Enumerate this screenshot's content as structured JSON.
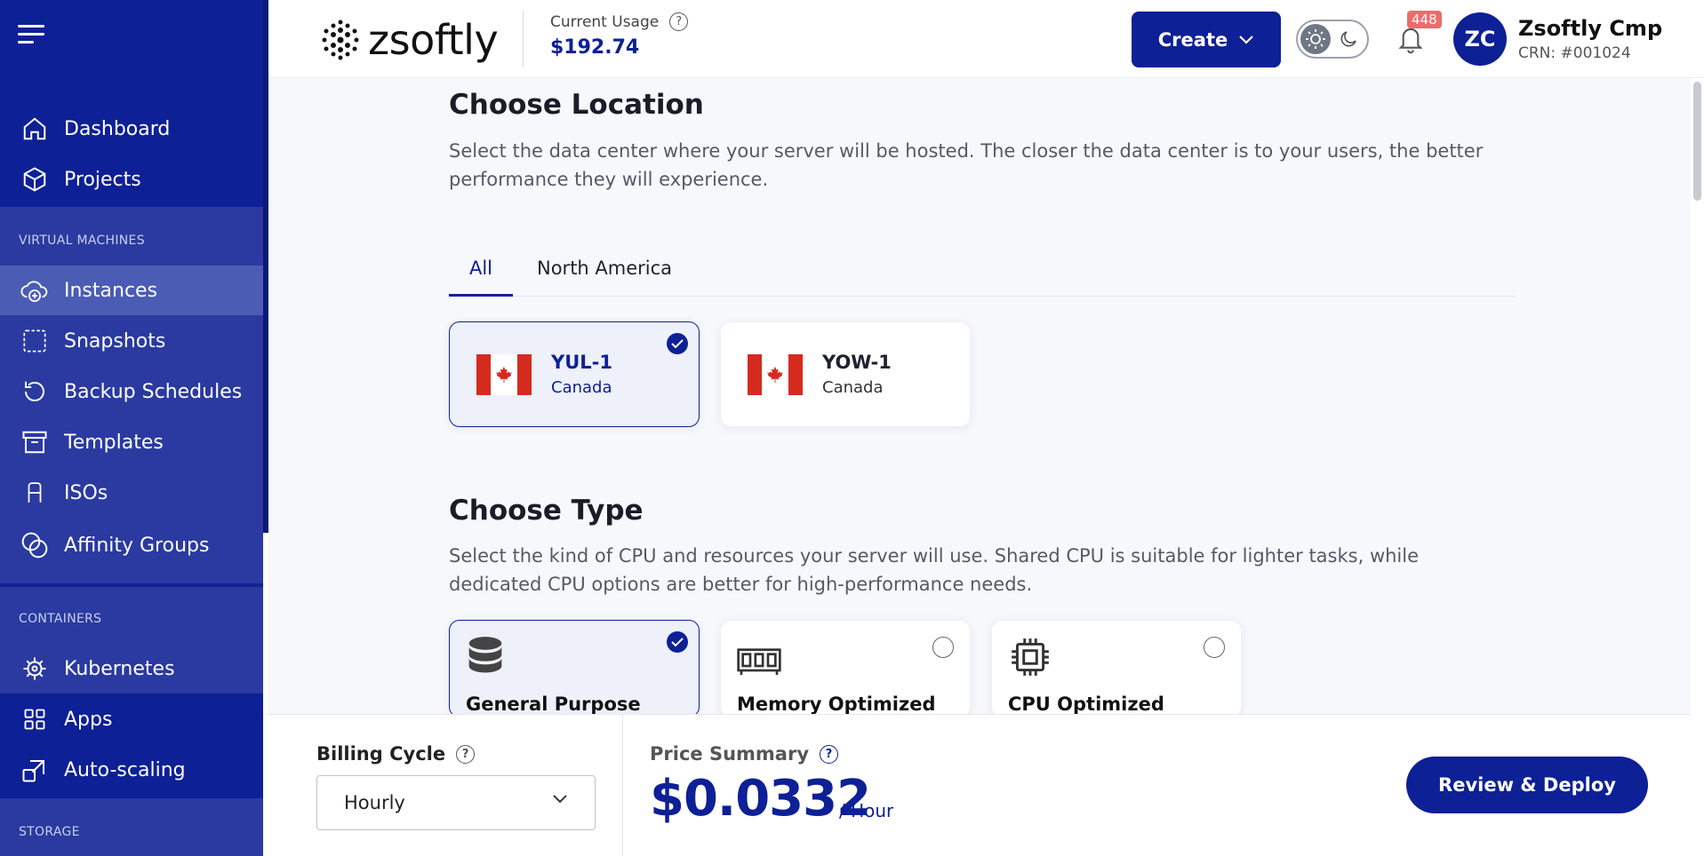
{
  "sidebar": {
    "items": [
      {
        "label": "Dashboard",
        "icon": "home-icon"
      },
      {
        "label": "Projects",
        "icon": "cube-icon"
      }
    ],
    "sections": [
      {
        "label": "VIRTUAL MACHINES",
        "items": [
          {
            "label": "Instances",
            "icon": "cloud-plus-icon",
            "active": true
          },
          {
            "label": "Snapshots",
            "icon": "camera-frame-icon"
          },
          {
            "label": "Backup Schedules",
            "icon": "history-icon"
          },
          {
            "label": "Templates",
            "icon": "archive-icon"
          },
          {
            "label": "ISOs",
            "icon": "disc-stack-icon"
          },
          {
            "label": "Affinity Groups",
            "icon": "overlap-circles-icon"
          }
        ]
      },
      {
        "label": "CONTAINERS",
        "items": [
          {
            "label": "Kubernetes",
            "icon": "helm-icon"
          },
          {
            "label": "Apps",
            "icon": "grid-icon"
          },
          {
            "label": "Auto-scaling",
            "icon": "scale-arrow-icon"
          }
        ]
      },
      {
        "label": "STORAGE",
        "items": []
      }
    ]
  },
  "header": {
    "logo_text": "zsoftly",
    "usage_label": "Current Usage",
    "usage_value": "$192.74",
    "create_label": "Create",
    "notification_count": "448",
    "avatar_initials": "ZC",
    "user_name": "Zsoftly Cmp",
    "user_crn": "CRN: #001024"
  },
  "location": {
    "title": "Choose Location",
    "description": "Select the data center where your server will be hosted. The closer the data center is to your users, the better performance they will experience.",
    "tabs": [
      "All",
      "North America"
    ],
    "active_tab": "All",
    "cards": [
      {
        "code": "YUL-1",
        "country": "Canada",
        "selected": true
      },
      {
        "code": "YOW-1",
        "country": "Canada",
        "selected": false
      }
    ]
  },
  "type": {
    "title": "Choose Type",
    "description": "Select the kind of CPU and resources your server will use. Shared CPU is suitable for lighter tasks, while dedicated CPU options are better for high-performance needs.",
    "cards": [
      {
        "label": "General Purpose",
        "icon": "database-icon",
        "selected": true
      },
      {
        "label": "Memory Optimized",
        "icon": "memory-icon",
        "selected": false
      },
      {
        "label": "CPU Optimized",
        "icon": "cpu-icon",
        "selected": false
      }
    ]
  },
  "footer": {
    "billing_label": "Billing Cycle",
    "billing_value": "Hourly",
    "price_label": "Price Summary",
    "price_value": "$0.0332",
    "price_unit": "/ Hour",
    "deploy_label": "Review & Deploy"
  },
  "colors": {
    "brand": "#0d2096",
    "sidebar_active": "#4b5cb4",
    "badge": "#ef6b6b"
  }
}
